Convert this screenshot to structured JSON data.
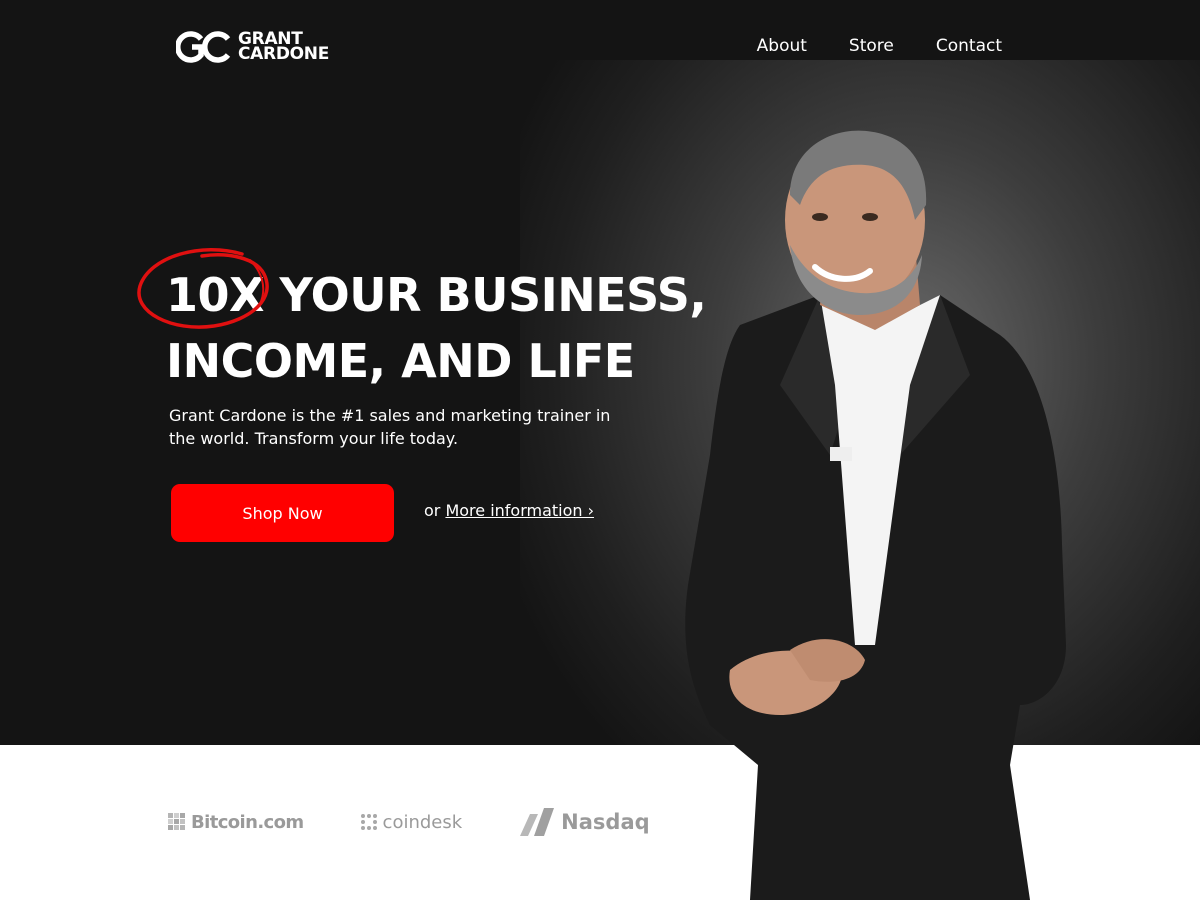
{
  "brand": {
    "logo_line1": "GRANT",
    "logo_line2": "CARDONE"
  },
  "nav": {
    "items": [
      "About",
      "Store",
      "Contact"
    ]
  },
  "hero": {
    "highlight": "10X",
    "headline_rest_line1": " YOUR BUSINESS,",
    "headline_line2": "INCOME, AND LIFE",
    "subtext": "Grant Cardone is the #1 sales and marketing trainer in the world. Transform your life today.",
    "cta_label": "Shop Now",
    "more_prefix": "or ",
    "more_link": "More information ›"
  },
  "partners": {
    "items": [
      "Bitcoin.com",
      "coindesk",
      "Nasdaq"
    ]
  },
  "colors": {
    "hero_bg": "#141414",
    "accent_red": "#ff0000",
    "partner_gray": "#9a9a9a"
  },
  "icons": {
    "logo": "gc-monogram-icon",
    "bitcoin": "bitcoin-pixel-icon",
    "coindesk": "coindesk-dots-icon",
    "nasdaq": "nasdaq-chevron-icon"
  }
}
